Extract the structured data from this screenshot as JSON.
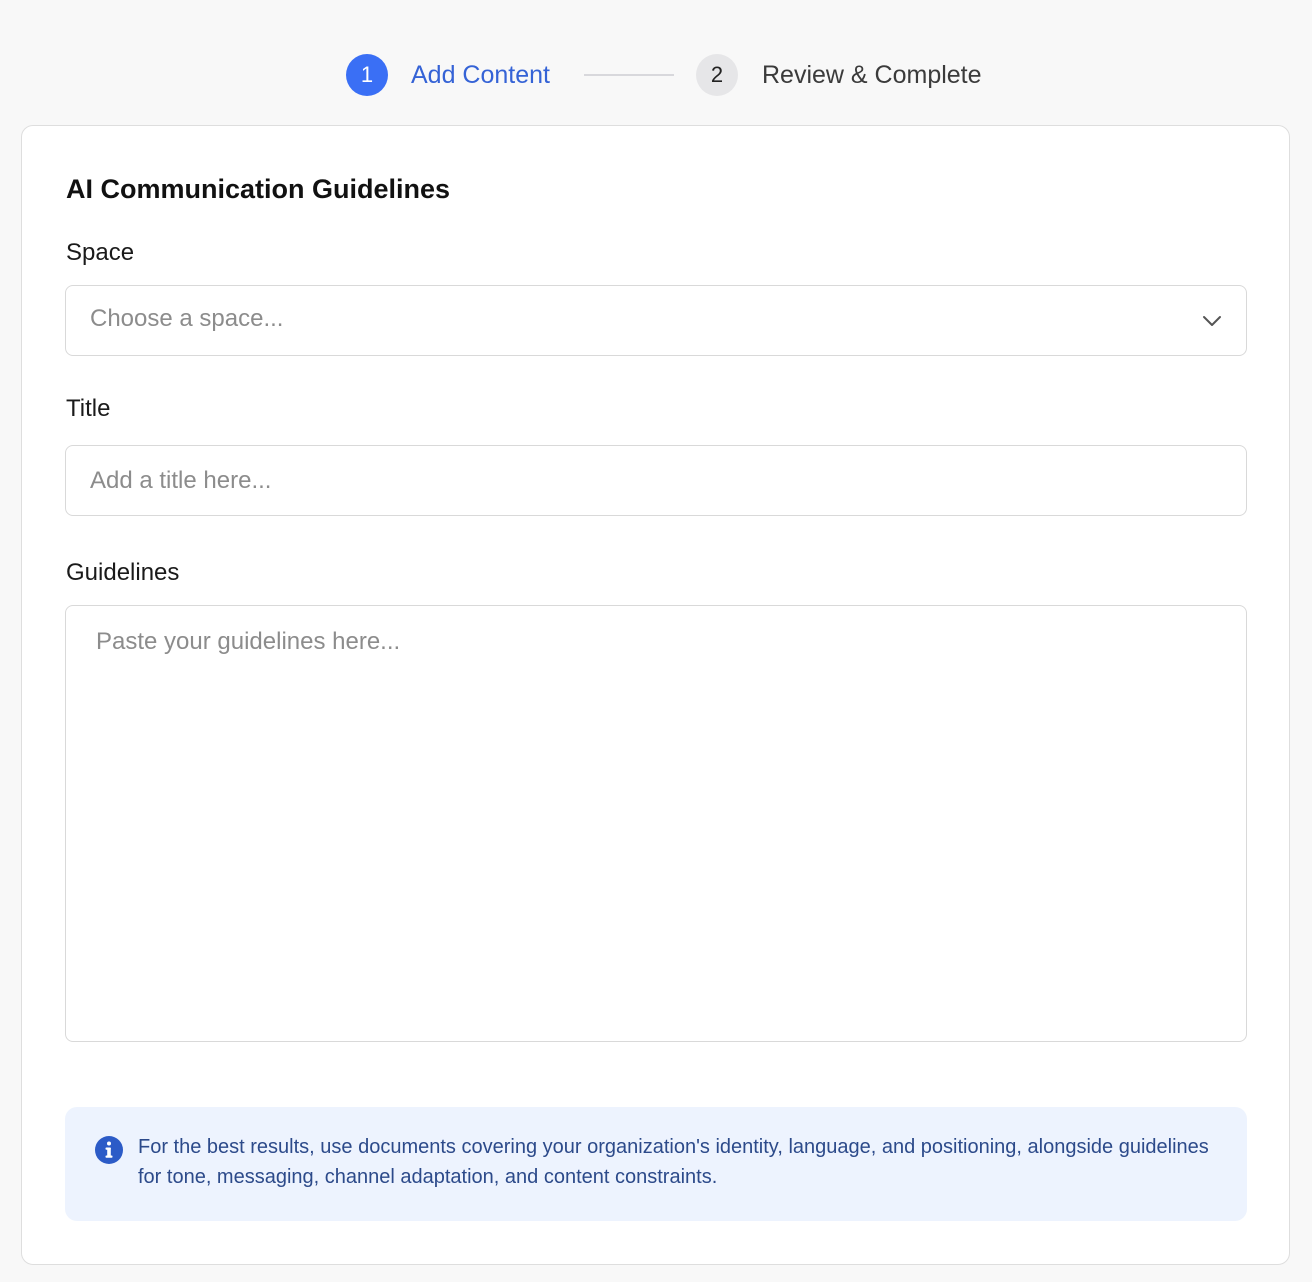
{
  "stepper": {
    "steps": [
      {
        "number": "1",
        "label": "Add Content",
        "state": "active"
      },
      {
        "number": "2",
        "label": "Review & Complete",
        "state": "inactive"
      }
    ]
  },
  "form": {
    "title": "AI Communication Guidelines",
    "space": {
      "label": "Space",
      "placeholder": "Choose a space...",
      "icon": "chevron-down-icon"
    },
    "title_field": {
      "label": "Title",
      "placeholder": "Add a title here..."
    },
    "guidelines": {
      "label": "Guidelines",
      "placeholder": "Paste your guidelines here..."
    },
    "info": {
      "icon": "info-icon",
      "text": "For the best results, use documents covering your organization's identity, language, and positioning, alongside guidelines for tone, messaging, channel adaptation, and content constraints."
    }
  },
  "colors": {
    "accent": "#3a6ff5",
    "accent_text": "#3563d6",
    "info_bg": "#edf3fe",
    "info_text": "#2c4a8a",
    "info_icon": "#2c5bc7"
  }
}
